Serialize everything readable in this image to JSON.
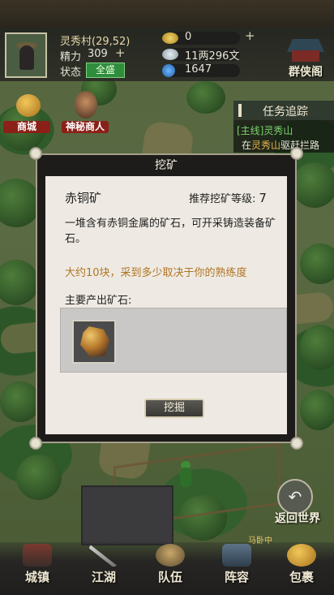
{
  "header": {
    "location": "灵秀村(29,52)",
    "energy_label": "精力",
    "energy_value": "309",
    "status_label": "状态",
    "status_value": "全盛",
    "gold": "0",
    "silver": "11两296文",
    "gems": "1647",
    "guild_label": "群侠阁"
  },
  "side": {
    "shop_label": "商城",
    "merchant_label": "神秘商人"
  },
  "quest": {
    "title": "任务追踪",
    "line1": "[主线]灵秀山",
    "line2_prefix": "在",
    "line2_place": "灵秀山",
    "line2_suffix": "驱赶拦路"
  },
  "dialog": {
    "title": "挖矿",
    "ore_name": "赤铜矿",
    "level_label": "推荐挖矿等级:",
    "level_value": "7",
    "description": "一堆含有赤铜金属的矿石，可开采铸造装备矿石。",
    "hint": "大约10块，采到多少取决于你的熟练度",
    "yield_label": "主要产出矿石:",
    "dig_button": "挖掘"
  },
  "return_label": "返回世界",
  "small_badge": "马卧中",
  "nav": [
    {
      "label": "城镇"
    },
    {
      "label": "江湖"
    },
    {
      "label": "队伍"
    },
    {
      "label": "阵容"
    },
    {
      "label": "包裹"
    }
  ],
  "colors": {
    "status_green": "#2f8d3e",
    "hint_orange": "#b17424",
    "quest_green": "#7ad46e",
    "quest_highlight": "#e6b64c",
    "dialog_panel": "#eeeae3"
  }
}
